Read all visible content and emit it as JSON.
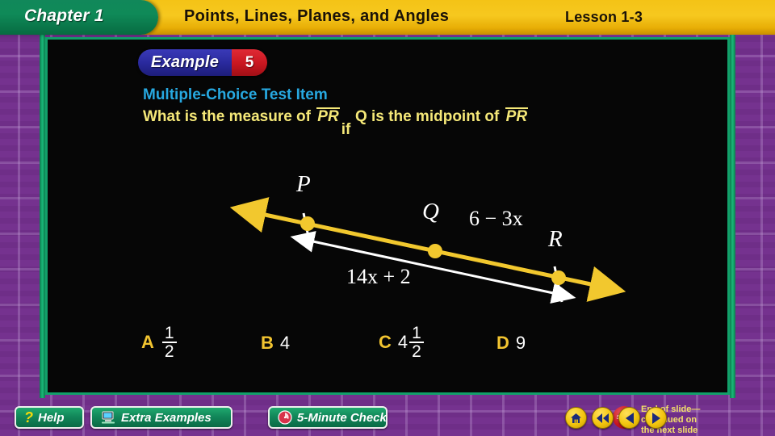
{
  "header": {
    "chapter": "Chapter 1",
    "title": "Points, Lines, Planes, and Angles",
    "lesson": "Lesson 1-3"
  },
  "example": {
    "word": "Example",
    "number": "5"
  },
  "prompt": {
    "heading": "Multiple-Choice Test Item",
    "question_part1": "What is the measure of",
    "question_segment1": "PR",
    "question_overlap": "if",
    "question_part2": "Q is the midpoint of",
    "question_segment2": "PR"
  },
  "diagram": {
    "point_p": "P",
    "point_q": "Q",
    "point_r": "R",
    "label_qr": "6 − 3x",
    "label_pr": "14x + 2",
    "line_color": "#f2c82e",
    "measure_color": "#ffffff"
  },
  "choices": [
    {
      "letter": "A",
      "value": "",
      "frac_num": "1",
      "frac_den": "2"
    },
    {
      "letter": "B",
      "value": "4",
      "frac_num": "",
      "frac_den": ""
    },
    {
      "letter": "C",
      "value": "4",
      "frac_num": "1",
      "frac_den": "2"
    },
    {
      "letter": "D",
      "value": "9",
      "frac_num": "",
      "frac_den": ""
    }
  ],
  "end_note": {
    "icon": "stop-sign-icon",
    "stop_text": "STOP",
    "text": "End of slide—\ncontinued on\nthe next slide"
  },
  "toolbar": {
    "help": "Help",
    "extra_examples": "Extra Examples",
    "five_minute_check": "5-Minute Check"
  },
  "nav": {
    "home": "home-icon",
    "first": "rewind-icon",
    "prev": "previous-icon",
    "next": "next-icon"
  },
  "colors": {
    "banner": "#f4c316",
    "chapter_tab": "#0f8a58",
    "stage": "#060606",
    "heading": "#27a8e0",
    "question": "#f5e878",
    "accent_yellow": "#f2c430",
    "border_purple": "#75328f"
  }
}
